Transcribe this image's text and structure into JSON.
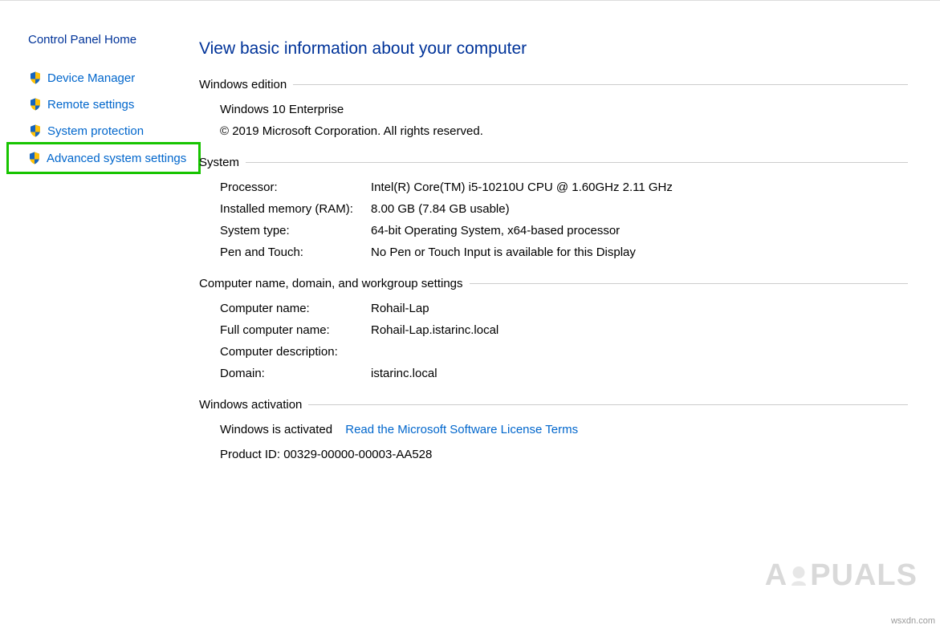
{
  "sidebar": {
    "home_label": "Control Panel Home",
    "links": [
      {
        "label": "Device Manager"
      },
      {
        "label": "Remote settings"
      },
      {
        "label": "System protection"
      },
      {
        "label": "Advanced system settings"
      }
    ]
  },
  "main": {
    "title": "View basic information about your computer",
    "windows_edition": {
      "header": "Windows edition",
      "name": "Windows 10 Enterprise",
      "copyright": "© 2019 Microsoft Corporation. All rights reserved."
    },
    "system": {
      "header": "System",
      "rows": [
        {
          "label": "Processor:",
          "value": "Intel(R) Core(TM) i5-10210U CPU @ 1.60GHz   2.11 GHz"
        },
        {
          "label": "Installed memory (RAM):",
          "value": "8.00 GB (7.84 GB usable)"
        },
        {
          "label": "System type:",
          "value": "64-bit Operating System, x64-based processor"
        },
        {
          "label": "Pen and Touch:",
          "value": "No Pen or Touch Input is available for this Display"
        }
      ]
    },
    "computer_name": {
      "header": "Computer name, domain, and workgroup settings",
      "rows": [
        {
          "label": "Computer name:",
          "value": "Rohail-Lap"
        },
        {
          "label": "Full computer name:",
          "value": "Rohail-Lap.istarinc.local"
        },
        {
          "label": "Computer description:",
          "value": ""
        },
        {
          "label": "Domain:",
          "value": "istarinc.local"
        }
      ]
    },
    "activation": {
      "header": "Windows activation",
      "status": "Windows is activated",
      "link": "Read the Microsoft Software License Terms",
      "product_id_label": "Product ID:",
      "product_id_value": "00329-00000-00003-AA528"
    }
  },
  "watermark": {
    "pre": "A",
    "post": "PUALS"
  },
  "attribution": "wsxdn.com"
}
